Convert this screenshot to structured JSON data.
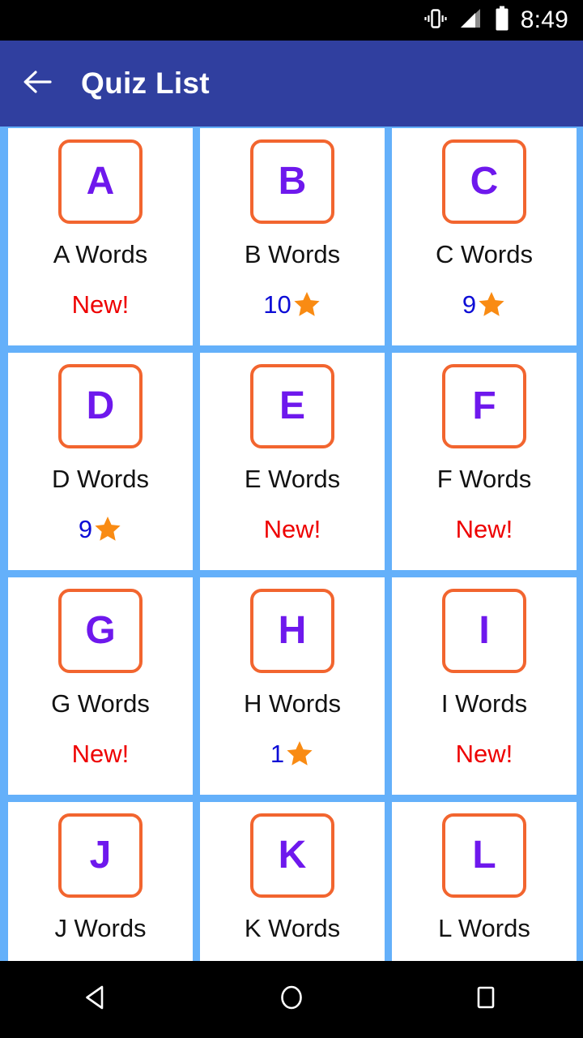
{
  "status_bar": {
    "time": "8:49",
    "icons": [
      "vibrate-icon",
      "signal-icon",
      "battery-icon"
    ]
  },
  "app_bar": {
    "back_icon": "arrow-left-icon",
    "title": "Quiz List",
    "background_color": "#303f9f"
  },
  "theme": {
    "grid_background": "#64b0fa",
    "card_background": "#ffffff",
    "letter_border": "#f2652f",
    "letter_color": "#6e18ed",
    "new_color": "#ee0000",
    "score_color": "#0d0dd6",
    "star_color": "#f98b13"
  },
  "quiz_grid": {
    "cards": [
      {
        "letter": "A",
        "title": "A Words",
        "status_type": "new",
        "status_label": "New!",
        "score": null
      },
      {
        "letter": "B",
        "title": "B Words",
        "status_type": "score",
        "status_label": "",
        "score": "10"
      },
      {
        "letter": "C",
        "title": "C Words",
        "status_type": "score",
        "status_label": "",
        "score": "9"
      },
      {
        "letter": "D",
        "title": "D Words",
        "status_type": "score",
        "status_label": "",
        "score": "9"
      },
      {
        "letter": "E",
        "title": "E Words",
        "status_type": "new",
        "status_label": "New!",
        "score": null
      },
      {
        "letter": "F",
        "title": "F Words",
        "status_type": "new",
        "status_label": "New!",
        "score": null
      },
      {
        "letter": "G",
        "title": "G Words",
        "status_type": "new",
        "status_label": "New!",
        "score": null
      },
      {
        "letter": "H",
        "title": "H Words",
        "status_type": "score",
        "status_label": "",
        "score": "1"
      },
      {
        "letter": "I",
        "title": "I Words",
        "status_type": "new",
        "status_label": "New!",
        "score": null
      },
      {
        "letter": "J",
        "title": "J Words",
        "status_type": "none",
        "status_label": "",
        "score": null
      },
      {
        "letter": "K",
        "title": "K Words",
        "status_type": "none",
        "status_label": "",
        "score": null
      },
      {
        "letter": "L",
        "title": "L Words",
        "status_type": "none",
        "status_label": "",
        "score": null
      }
    ]
  },
  "nav_bar": {
    "buttons": [
      {
        "name": "nav-back-button",
        "icon": "triangle-back-icon"
      },
      {
        "name": "nav-home-button",
        "icon": "circle-home-icon"
      },
      {
        "name": "nav-recents-button",
        "icon": "square-recents-icon"
      }
    ]
  }
}
